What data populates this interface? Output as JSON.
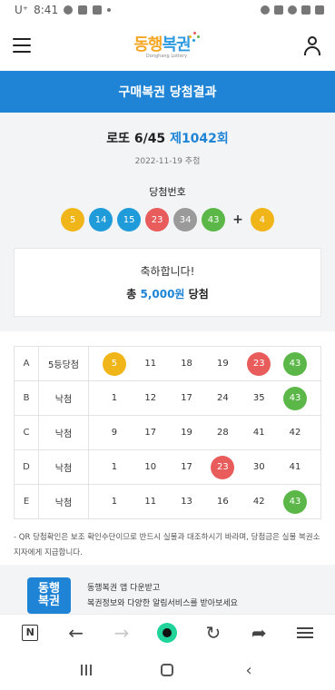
{
  "status_bar": {
    "carrier": "U⁺",
    "time": "8:41"
  },
  "header": {
    "logo_text_1": "동행",
    "logo_text_2": "복권",
    "logo_sub": "Donghang Lottery"
  },
  "page_title": "구매복권 당첨결과",
  "draw": {
    "game": "로또 6/45",
    "round": "제1042회",
    "date": "2022-11-19 추첨",
    "winning_label": "당첨번호",
    "numbers": [
      {
        "n": "5",
        "color": "#f0b619"
      },
      {
        "n": "14",
        "color": "#1f9bd9"
      },
      {
        "n": "15",
        "color": "#1f9bd9"
      },
      {
        "n": "23",
        "color": "#e85c5c"
      },
      {
        "n": "34",
        "color": "#9a9a9a"
      },
      {
        "n": "43",
        "color": "#5bb848"
      }
    ],
    "plus": "+",
    "bonus": {
      "n": "4",
      "color": "#f0b619"
    }
  },
  "result": {
    "congrats": "축하합니다!",
    "prize_prefix": "총",
    "prize_amount": "5,000원",
    "prize_suffix": "당첨"
  },
  "tickets": [
    {
      "slot": "A",
      "status": "5등당첨",
      "numbers": [
        {
          "n": "5",
          "hit": true,
          "color": "#f0b619"
        },
        {
          "n": "11",
          "hit": false
        },
        {
          "n": "18",
          "hit": false
        },
        {
          "n": "19",
          "hit": false
        },
        {
          "n": "23",
          "hit": true,
          "color": "#e85c5c"
        },
        {
          "n": "43",
          "hit": true,
          "color": "#5bb848"
        }
      ]
    },
    {
      "slot": "B",
      "status": "낙첨",
      "numbers": [
        {
          "n": "1",
          "hit": false
        },
        {
          "n": "12",
          "hit": false
        },
        {
          "n": "17",
          "hit": false
        },
        {
          "n": "24",
          "hit": false
        },
        {
          "n": "35",
          "hit": false
        },
        {
          "n": "43",
          "hit": true,
          "color": "#5bb848"
        }
      ]
    },
    {
      "slot": "C",
      "status": "낙첨",
      "numbers": [
        {
          "n": "9",
          "hit": false
        },
        {
          "n": "17",
          "hit": false
        },
        {
          "n": "19",
          "hit": false
        },
        {
          "n": "28",
          "hit": false
        },
        {
          "n": "41",
          "hit": false
        },
        {
          "n": "42",
          "hit": false
        }
      ]
    },
    {
      "slot": "D",
      "status": "낙첨",
      "numbers": [
        {
          "n": "1",
          "hit": false
        },
        {
          "n": "10",
          "hit": false
        },
        {
          "n": "17",
          "hit": false
        },
        {
          "n": "23",
          "hit": true,
          "color": "#e85c5c"
        },
        {
          "n": "30",
          "hit": false
        },
        {
          "n": "41",
          "hit": false
        }
      ]
    },
    {
      "slot": "E",
      "status": "낙첨",
      "numbers": [
        {
          "n": "1",
          "hit": false
        },
        {
          "n": "11",
          "hit": false
        },
        {
          "n": "13",
          "hit": false
        },
        {
          "n": "16",
          "hit": false
        },
        {
          "n": "42",
          "hit": false
        },
        {
          "n": "43",
          "hit": true,
          "color": "#5bb848"
        }
      ]
    }
  ],
  "notice": "- QR 당첨확인은 보조 확인수단이므로 반드시 실물과 대조하시기 바라며, 당첨금은 실물 복권소지자에게 지급합니다.",
  "promo": {
    "logo_line1": "동행",
    "logo_line2": "복권",
    "line1": "동행복권 앱 다운받고",
    "line2": "복권정보와 다양한 알림서비스를 받아보세요"
  },
  "browser_bar": {
    "tab_label": "N",
    "back": "←",
    "forward": "→",
    "reload": "↻",
    "share": "➦"
  },
  "system_nav": {
    "back": "‹"
  }
}
